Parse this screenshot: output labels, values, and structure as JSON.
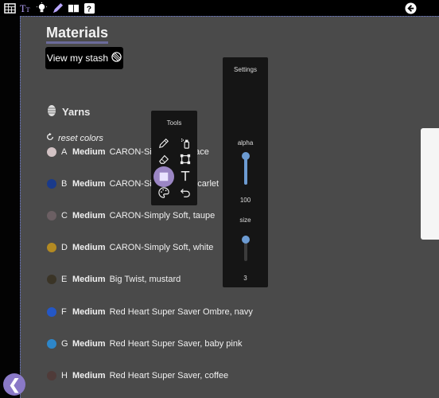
{
  "toolbar": {
    "icons": [
      "knitting-chart-icon",
      "text-tool-icon",
      "lightbulb-icon",
      "pen-icon",
      "book-icon",
      "help-icon"
    ],
    "back_icon": "back-arrow-icon"
  },
  "materials": {
    "title": "Materials",
    "stash_button": "View my stash",
    "yarns_heading": "Yarns",
    "reset_label": "reset colors",
    "yarns": [
      {
        "letter": "A",
        "weight": "Medium",
        "name": "CARON-Simply Soft, lace",
        "color": "#d2c2c4"
      },
      {
        "letter": "B",
        "weight": "Medium",
        "name": "CARON-Simply Soft, scarlet",
        "color": "#1a3a8a"
      },
      {
        "letter": "C",
        "weight": "Medium",
        "name": "CARON-Simply Soft, taupe",
        "color": "#6b5f63"
      },
      {
        "letter": "D",
        "weight": "Medium",
        "name": "CARON-Simply Soft, white",
        "color": "#b38a22"
      },
      {
        "letter": "E",
        "weight": "Medium",
        "name": "Big Twist, mustard",
        "color": "#3a3426"
      },
      {
        "letter": "F",
        "weight": "Medium",
        "name": "Red Heart Super Saver Ombre, navy",
        "color": "#2457c6"
      },
      {
        "letter": "G",
        "weight": "Medium",
        "name": "Red Heart Super Saver, baby pink",
        "color": "#2d86c9"
      },
      {
        "letter": "H",
        "weight": "Medium",
        "name": "Red Heart Super Saver, coffee",
        "color": "#4f3b39"
      }
    ]
  },
  "tools": {
    "title": "Tools",
    "items": [
      "pen-icon",
      "spray-bottle-icon",
      "eraser-icon",
      "select-box-icon",
      "square-icon",
      "text-icon",
      "palette-icon",
      "undo-icon"
    ]
  },
  "settings": {
    "title": "Settings",
    "alpha_label": "alpha",
    "alpha_value": "100",
    "alpha_fraction": 1.0,
    "size_label": "size",
    "size_value": "3",
    "size_fraction": 0.25
  },
  "colors": {
    "accent": "#8a79c7",
    "slider": "#6c9bd2"
  }
}
